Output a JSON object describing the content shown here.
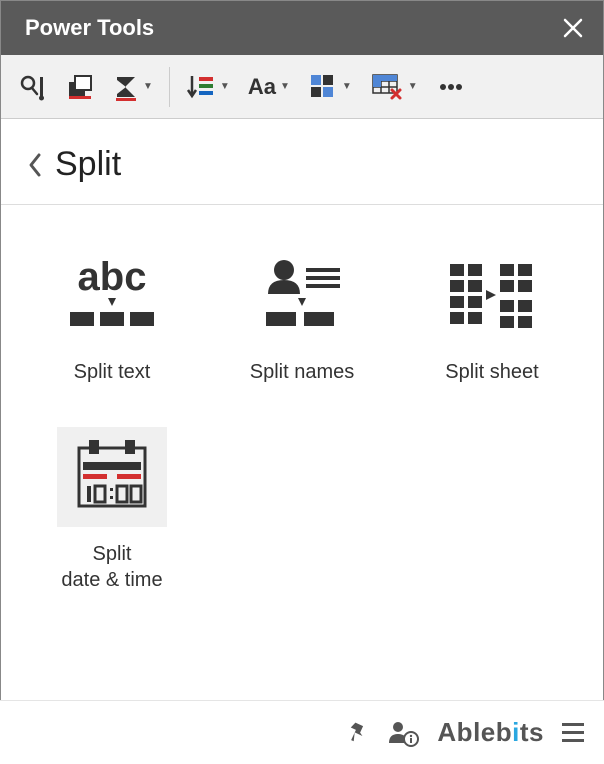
{
  "titlebar": {
    "title": "Power Tools"
  },
  "toolbar": {
    "icons": [
      "smart-toolbar-icon",
      "dedupe-icon",
      "sum-icon",
      "sort-icon",
      "text-case-icon",
      "merge-icon",
      "clear-icon",
      "more-icon"
    ]
  },
  "breadcrumb": {
    "label": "Split"
  },
  "tiles": [
    {
      "key": "split-text",
      "label": "Split text",
      "selected": false
    },
    {
      "key": "split-names",
      "label": "Split names",
      "selected": false
    },
    {
      "key": "split-sheet",
      "label": "Split sheet",
      "selected": false
    },
    {
      "key": "split-date-time",
      "label": "Split\ndate & time",
      "selected": true
    }
  ],
  "footer": {
    "brand": "Ablebits"
  }
}
